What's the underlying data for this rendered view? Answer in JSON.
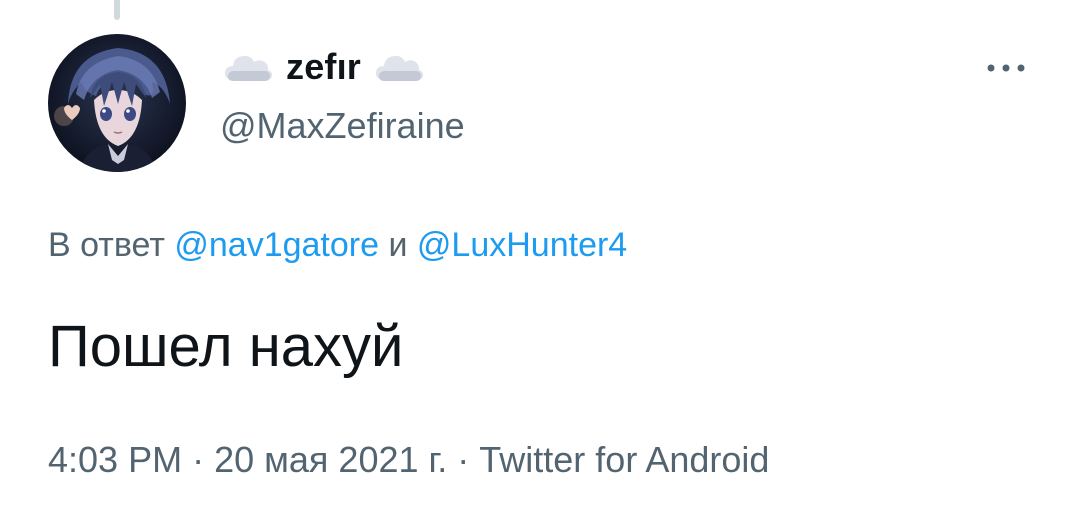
{
  "tweet": {
    "author": {
      "display_name": "zefır",
      "handle": "@MaxZefiraine",
      "name_decoration_icon": "cloud-icon",
      "avatar_icon": "anime-avatar"
    },
    "menu_icon": "more-horizontal-icon",
    "reply_to": {
      "prefix": "В ответ",
      "mentions": [
        "@nav1gatore",
        "@LuxHunter4"
      ],
      "conjunction": "и"
    },
    "text": "Пошел нахуй",
    "meta": {
      "time": "4:03 PM",
      "separator": "·",
      "date": "20 мая 2021 г.",
      "source": "Twitter for Android"
    }
  },
  "colors": {
    "text_primary": "#0f1419",
    "text_secondary": "#536471",
    "link": "#1d9bf0",
    "thread_line": "#cfd9de"
  }
}
